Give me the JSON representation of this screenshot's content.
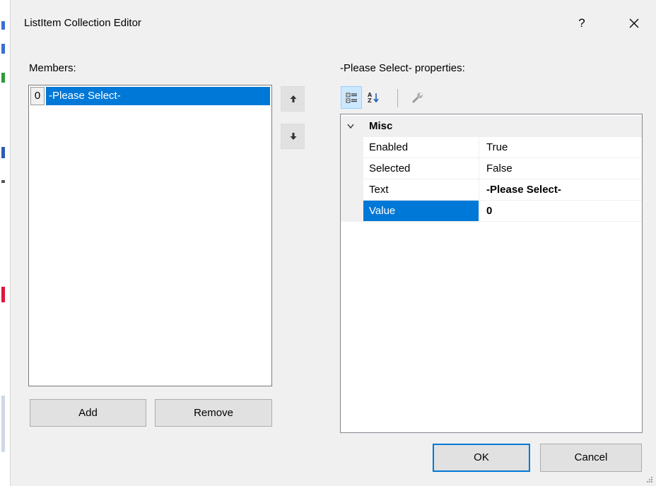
{
  "window": {
    "title": "ListItem Collection Editor",
    "help_label": "?",
    "close_icon": "close-icon"
  },
  "members": {
    "label": "Members:",
    "items": [
      {
        "index": "0",
        "text": "-Please Select-",
        "selected": true
      }
    ],
    "move_up_icon": "arrow-up-icon",
    "move_down_icon": "arrow-down-icon",
    "add_label": "Add",
    "remove_label": "Remove"
  },
  "properties": {
    "label": "-Please Select- properties:",
    "toolbar": {
      "categorized_icon": "categorized-icon",
      "alphabetical_icon": "alphabetical-sort-icon",
      "property_pages_icon": "wrench-icon"
    },
    "category": "Misc",
    "rows": [
      {
        "name": "Enabled",
        "value": "True"
      },
      {
        "name": "Selected",
        "value": "False"
      },
      {
        "name": "Text",
        "value": "-Please Select-"
      },
      {
        "name": "Value",
        "value": "0"
      }
    ]
  },
  "footer": {
    "ok_label": "OK",
    "cancel_label": "Cancel"
  },
  "colors": {
    "selection": "#0078d7",
    "dialog_background": "#f0f0f0",
    "button_face": "#e1e1e1"
  }
}
